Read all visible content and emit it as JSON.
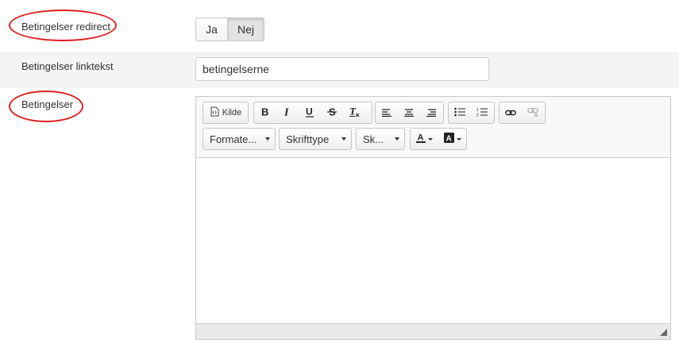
{
  "fields": {
    "redirect": {
      "label": "Betingelser redirect",
      "options": [
        "Ja",
        "Nej"
      ],
      "selected": "Nej"
    },
    "linktext": {
      "label": "Betingelser linktekst",
      "value": "betingelserne"
    },
    "terms": {
      "label": "Betingelser"
    }
  },
  "editor": {
    "source_label": "Kilde",
    "format_label": "Formate...",
    "font_label": "Skrifttype",
    "size_label": "Sk...",
    "toolbar_icons": [
      "source-icon",
      "bold-icon",
      "italic-icon",
      "underline-icon",
      "strikethrough-icon",
      "remove-format-icon",
      "align-left-icon",
      "align-center-icon",
      "align-right-icon",
      "bulleted-list-icon",
      "numbered-list-icon",
      "link-icon",
      "unlink-icon",
      "text-color-icon",
      "background-color-icon"
    ],
    "content": ""
  },
  "colors": {
    "annotation": "#dd1f1f",
    "row_band": "#f4f4f4",
    "selected_toggle": "#e3e3e3"
  }
}
